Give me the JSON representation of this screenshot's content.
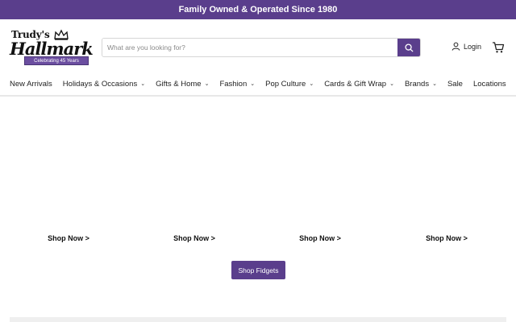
{
  "announcement": "Family Owned & Operated Since 1980",
  "logo": {
    "line1": "Trudy's",
    "line2": "Hallmark",
    "ribbon": "Celebrating 45 Years"
  },
  "search": {
    "placeholder": "What are you looking for?"
  },
  "account": {
    "login_label": "Login"
  },
  "nav": {
    "items": [
      {
        "label": "New Arrivals"
      },
      {
        "label": "Holidays & Occasions"
      },
      {
        "label": "Gifts & Home"
      },
      {
        "label": "Fashion"
      },
      {
        "label": "Pop Culture"
      },
      {
        "label": "Cards & Gift Wrap"
      },
      {
        "label": "Brands"
      },
      {
        "label": "Sale"
      },
      {
        "label": "Locations"
      }
    ]
  },
  "products": [
    {
      "link": "Shop Now >"
    },
    {
      "link": "Shop Now >"
    },
    {
      "link": "Shop Now >"
    },
    {
      "link": "Shop Now >"
    }
  ],
  "cta": {
    "label": "Shop Fidgets"
  },
  "colors": {
    "brand": "#5a3e8c",
    "divider": "#e8e8e8"
  }
}
